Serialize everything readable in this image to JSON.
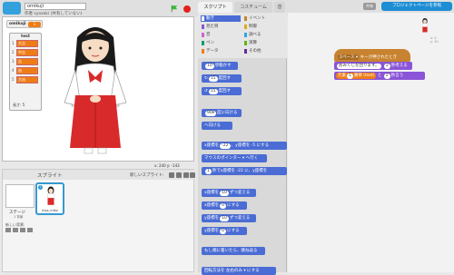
{
  "project": {
    "title": "omikuji",
    "author_line": "作者 syozaki (共有していない)"
  },
  "stage": {
    "variable": {
      "name": "omikuji",
      "value": "1"
    },
    "list": {
      "title": "test",
      "items": [
        "大吉",
        "中吉",
        "吉",
        "凶",
        "大凶"
      ],
      "length_label": "長さ: 5"
    },
    "coords": "x: 240  y: -143"
  },
  "sprites": {
    "title": "スプライト",
    "new_sprite_label": "新しいスプライト:",
    "stage_label": "ステージ",
    "stage_sub": "1 背景",
    "new_backdrop_label": "新しい背景:",
    "sprite_name": "jinja_miko",
    "sprite_info": "i"
  },
  "tabs": [
    "スクリプト",
    "コスチューム",
    "音"
  ],
  "buttons": {
    "share": "共有",
    "project_page": "プロジェクトページを参照"
  },
  "categories": {
    "left": [
      {
        "label": "動き",
        "color": "#4a6cd4"
      },
      {
        "label": "見た目",
        "color": "#8a55d7"
      },
      {
        "label": "音",
        "color": "#cf63cf"
      },
      {
        "label": "ペン",
        "color": "#0e9a6c"
      },
      {
        "label": "データ",
        "color": "#ee7d16"
      }
    ],
    "right": [
      {
        "label": "イベント",
        "color": "#c88330"
      },
      {
        "label": "制御",
        "color": "#e1a91a"
      },
      {
        "label": "調べる",
        "color": "#2ca5e2"
      },
      {
        "label": "演算",
        "color": "#5cb712"
      },
      {
        "label": "その他",
        "color": "#632d99"
      }
    ]
  },
  "palette_blocks": [
    {
      "pre": "",
      "num": "10",
      "post": "歩動かす"
    },
    {
      "pre": "↻",
      "num": "15",
      "post": "度回す"
    },
    {
      "pre": "↺",
      "num": "15",
      "post": "度回す"
    },
    {
      "pre": "",
      "num": "90▾",
      "post": "度に向ける"
    },
    {
      "pre": "",
      "num": "",
      "post": "へ向ける"
    },
    {
      "pre": "x座標を",
      "num": "-22",
      "post": "、y座標を -5 にする"
    },
    {
      "pre": "",
      "num": "",
      "post": "マウスのポインター ▾ へ行く"
    },
    {
      "pre": "",
      "num": "1",
      "post": "秒でx座標を -22 に、y座標を"
    },
    {
      "pre": "x座標を",
      "num": "10",
      "post": "ずつ変える"
    },
    {
      "pre": "x座標を",
      "num": "0",
      "post": "にする"
    },
    {
      "pre": "y座標を",
      "num": "10",
      "post": "ずつ変える"
    },
    {
      "pre": "y座標を",
      "num": "0",
      "post": "にする"
    },
    {
      "pre": "",
      "num": "",
      "post": "もし端に着いたら、跳ね返る"
    },
    {
      "pre": "",
      "num": "",
      "post": "回転方法を 左右のみ ▾ にする"
    }
  ],
  "script": {
    "hat": {
      "pre": "スペース ▾",
      "post": "キーが押されたとき"
    },
    "say_block": {
      "pre": "おみくじを回ります。",
      "num": "2",
      "post": "秒考える"
    },
    "list_block": {
      "pre": "元素",
      "list_pre": "番目 (",
      "list": "test",
      "list_post": ")",
      "num": "2",
      "post": "秒言う"
    },
    "sprite_coords": "x: 2\ny: 10"
  }
}
